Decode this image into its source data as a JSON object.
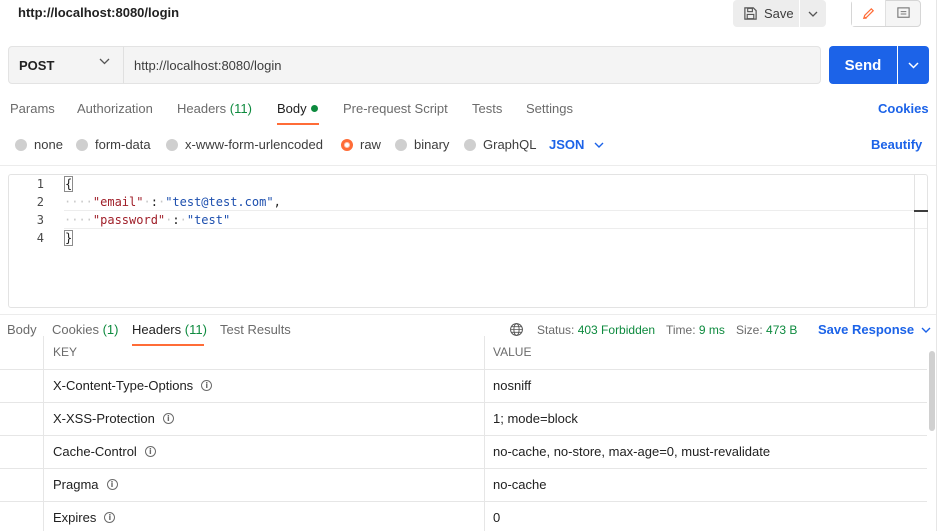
{
  "header": {
    "title": "http://localhost:8080/login",
    "save_label": "Save"
  },
  "request": {
    "method": "POST",
    "url": "http://localhost:8080/login",
    "send_label": "Send"
  },
  "tabs": {
    "params": "Params",
    "authorization": "Authorization",
    "headers": "Headers",
    "headers_count": "(11)",
    "body": "Body",
    "pre_request": "Pre-request Script",
    "tests": "Tests",
    "settings": "Settings",
    "cookies": "Cookies"
  },
  "body_types": {
    "none": "none",
    "form_data": "form-data",
    "urlencoded": "x-www-form-urlencoded",
    "raw": "raw",
    "binary": "binary",
    "graphql": "GraphQL",
    "format": "JSON",
    "beautify": "Beautify"
  },
  "editor": {
    "line_numbers": [
      "1",
      "2",
      "3",
      "4"
    ],
    "open_brace": "{",
    "close_brace": "}",
    "email_key": "\"email\"",
    "email_value": "\"test@test.com\"",
    "password_key": "\"password\"",
    "password_value": "\"test\""
  },
  "response": {
    "tabs": {
      "body": "Body",
      "cookies": "Cookies",
      "cookies_count": "(1)",
      "headers": "Headers",
      "headers_count": "(11)",
      "test_results": "Test Results"
    },
    "status_label": "Status:",
    "status_value": "403 Forbidden",
    "time_label": "Time:",
    "time_value": "9 ms",
    "size_label": "Size:",
    "size_value": "473 B",
    "save_response": "Save Response",
    "columns": {
      "key": "KEY",
      "value": "VALUE"
    },
    "rows": [
      {
        "key": "X-Content-Type-Options",
        "value": "nosniff"
      },
      {
        "key": "X-XSS-Protection",
        "value": "1; mode=block"
      },
      {
        "key": "Cache-Control",
        "value": "no-cache, no-store, max-age=0, must-revalidate"
      },
      {
        "key": "Pragma",
        "value": "no-cache"
      },
      {
        "key": "Expires",
        "value": "0"
      }
    ]
  },
  "colors": {
    "accent_orange": "#ff6c37",
    "send_blue": "#1c63e8",
    "status_green": "#0d8a3e"
  },
  "icons": {
    "save": "save-icon",
    "edit": "pencil-icon",
    "comments": "comment-icon",
    "globe": "globe-icon",
    "info": "info-icon"
  }
}
